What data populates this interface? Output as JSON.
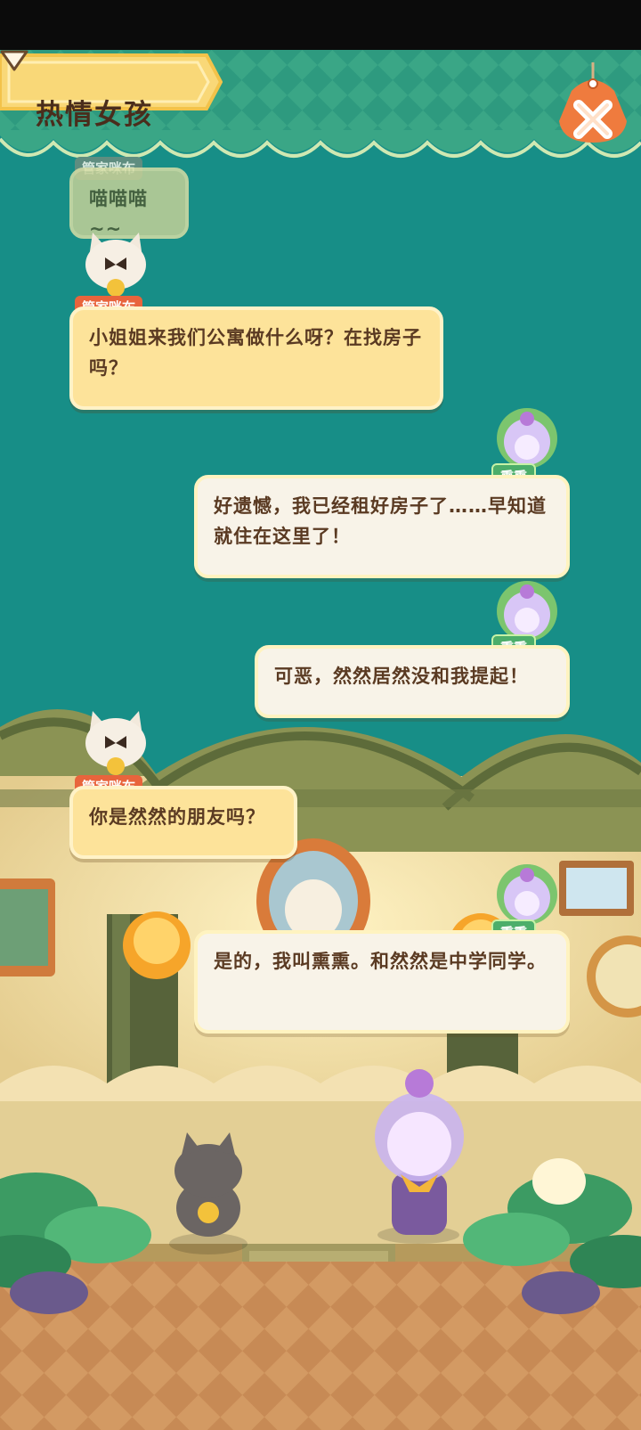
{
  "header": {
    "title": "热情女孩",
    "close_icon": "close-x-icon"
  },
  "colors": {
    "teal_background": "#178e87",
    "title_banner": "#f9d878",
    "close_button": "#ef7b3e",
    "cat_bubble": "#fde39a",
    "girl_bubble": "#f8f3e8",
    "cat_tag": "#e8643c",
    "girl_tag": "#4cae6a"
  },
  "dialogue": [
    {
      "speaker": "管家咪布",
      "text": "喵喵喵~~",
      "side": "left",
      "style": "faded"
    },
    {
      "speaker": "管家咪布",
      "text": "小姐姐来我们公寓做什么呀？在找房子吗？",
      "side": "left"
    },
    {
      "speaker": "熏熏",
      "text": "好遗憾，我已经租好房子了……早知道就住在这里了！",
      "side": "right"
    },
    {
      "speaker": "熏熏",
      "text": "可恶，然然居然没和我提起！",
      "side": "right"
    },
    {
      "speaker": "管家咪布",
      "text": "你是然然的朋友吗？",
      "side": "left"
    },
    {
      "speaker": "熏熏",
      "text": "是的，我叫熏熏。和然然是中学同学。",
      "side": "right"
    }
  ],
  "icons": {
    "next": "next-triangle-icon",
    "cat_avatar": "cat-butler-avatar",
    "girl_avatar": "candle-girl-avatar"
  }
}
